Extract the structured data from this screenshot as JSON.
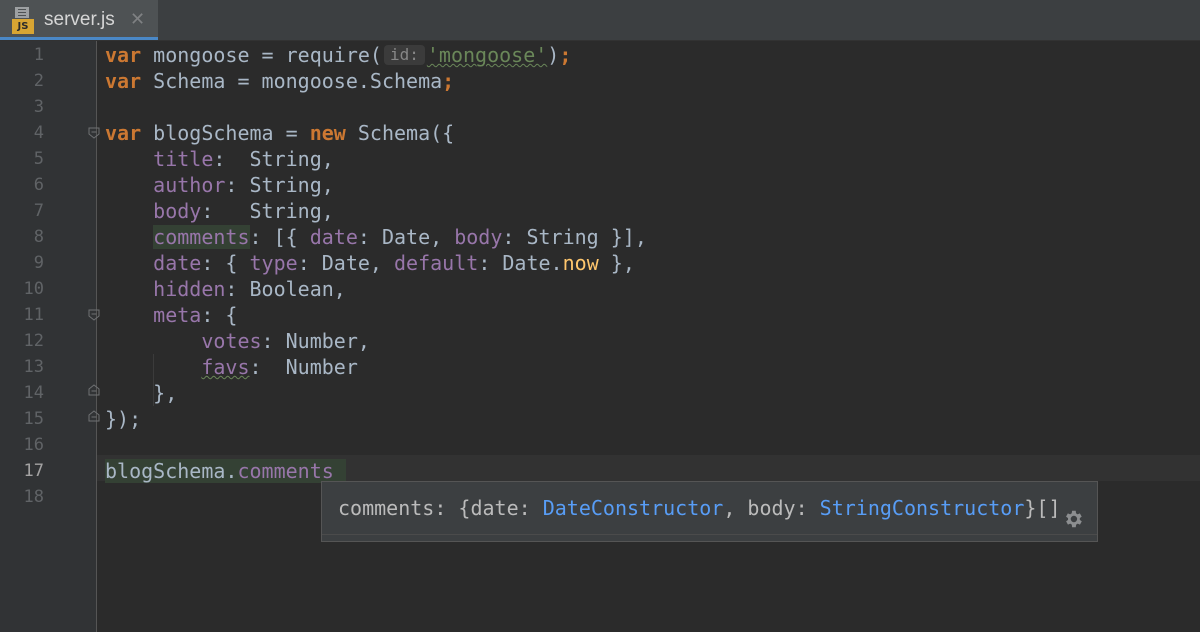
{
  "tab": {
    "filename": "server.js",
    "file_badge": "JS",
    "close_glyph": "✕"
  },
  "line_numbers": [
    "1",
    "2",
    "3",
    "4",
    "5",
    "6",
    "7",
    "8",
    "9",
    "10",
    "11",
    "12",
    "13",
    "14",
    "15",
    "16",
    "17",
    "18"
  ],
  "active_line": "17",
  "code": {
    "l1": {
      "kw": "var",
      "a": " mongoose = require(",
      "hint": "id:",
      "str": "'mongoose'",
      "b": ")",
      "semi": ";"
    },
    "l2": {
      "kw": "var",
      "a": " Schema = mongoose.Schema",
      "semi": ";"
    },
    "l4": {
      "kw": "var",
      "a": " blogSchema = ",
      "kw2": "new",
      "b": " Schema({"
    },
    "l5": {
      "indent": "    ",
      "prop": "title",
      "a": ":  String,"
    },
    "l6": {
      "indent": "    ",
      "prop": "author",
      "a": ": String,"
    },
    "l7": {
      "indent": "    ",
      "prop": "body",
      "a": ":   String,"
    },
    "l8": {
      "indent": "    ",
      "prop": "comments",
      "a": ": [{ ",
      "p2": "date",
      "b": ": Date, ",
      "p3": "body",
      "c": ": String }],"
    },
    "l9": {
      "indent": "    ",
      "prop": "date",
      "a": ": { ",
      "p2": "type",
      "b": ": Date, ",
      "p3": "default",
      "c": ": Date.",
      "fn": "now",
      "d": " },"
    },
    "l10": {
      "indent": "    ",
      "prop": "hidden",
      "a": ": Boolean,"
    },
    "l11": {
      "indent": "    ",
      "prop": "meta",
      "a": ": {"
    },
    "l12": {
      "indent": "        ",
      "prop": "votes",
      "a": ": Number,"
    },
    "l13": {
      "indent": "        ",
      "prop": "favs",
      "a": ":  Number"
    },
    "l14": {
      "text": "    },"
    },
    "l15": {
      "text": "});"
    },
    "l17": {
      "a": "blogSchema.",
      "prop": "comments"
    }
  },
  "popup": {
    "prefix": "comments: {date: ",
    "type1": "DateConstructor",
    "mid": ", body: ",
    "type2": "StringConstructor",
    "suffix": "}[]",
    "settings_icon": "gear-icon"
  },
  "colors": {
    "keyword": "#cc7832",
    "property": "#9876aa",
    "string": "#6a8759",
    "type": "#589df6",
    "background": "#2b2b2b"
  }
}
